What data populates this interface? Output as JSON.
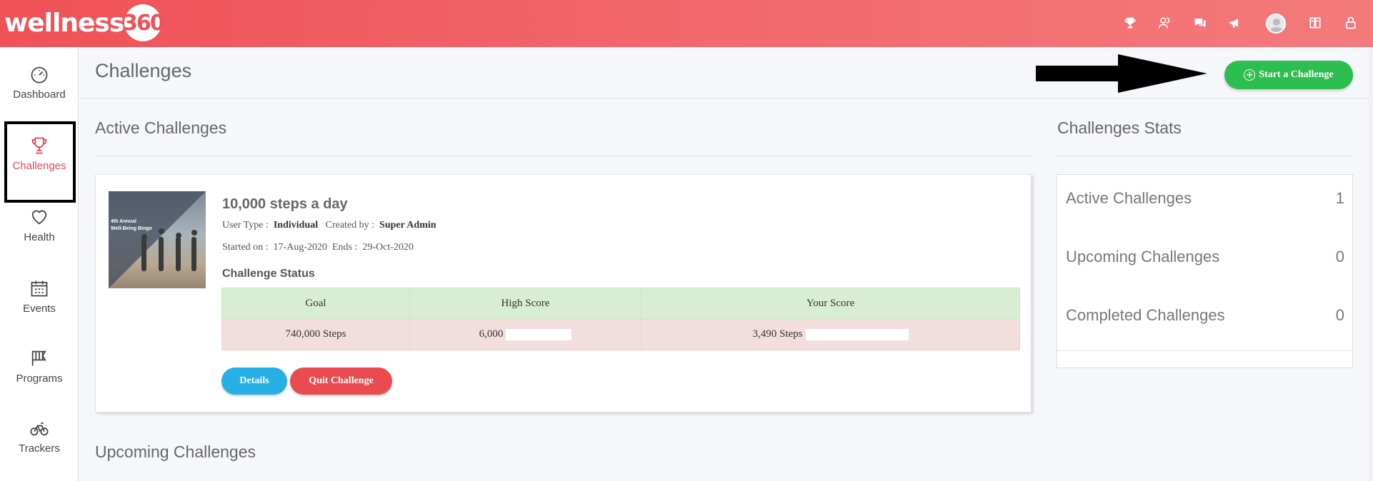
{
  "brand": {
    "name": "wellness",
    "badge": "360"
  },
  "topbar": {
    "icons": [
      "trophy-icon",
      "users-icon",
      "chat-icon",
      "megaphone-icon",
      "avatar",
      "book-icon",
      "lock-icon"
    ]
  },
  "sidebar": {
    "items": [
      {
        "label": "Dashboard",
        "icon": "speedometer-icon"
      },
      {
        "label": "Challenges",
        "icon": "trophy-icon",
        "active": true
      },
      {
        "label": "Health",
        "icon": "heart-icon"
      },
      {
        "label": "Events",
        "icon": "calendar-icon"
      },
      {
        "label": "Programs",
        "icon": "flag-icon"
      },
      {
        "label": "Trackers",
        "icon": "bicycle-icon"
      }
    ]
  },
  "header": {
    "title": "Challenges",
    "start_button": "Start a Challenge"
  },
  "active_section": {
    "title": "Active Challenges",
    "challenge": {
      "thumb_caption_line1": "4th Annual",
      "thumb_caption_line2": "Well-Being Bingo",
      "title": "10,000 steps a day",
      "user_type_label": "User Type :",
      "user_type": "Individual",
      "created_by_label": "Created by :",
      "created_by": "Super Admin",
      "started_label": "Started on :",
      "started": "17-Aug-2020",
      "ends_label": "Ends :",
      "ends": "29-Oct-2020",
      "status_label": "Challenge Status",
      "table": {
        "headers": [
          "Goal",
          "High Score",
          "Your Score"
        ],
        "goal": "740,000 Steps",
        "high_score": "6,000",
        "your_score": "3,490 Steps"
      },
      "details_button": "Details",
      "quit_button": "Quit Challenge"
    }
  },
  "upcoming_section": {
    "title": "Upcoming Challenges"
  },
  "stats": {
    "title": "Challenges Stats",
    "rows": [
      {
        "label": "Active Challenges",
        "value": "1"
      },
      {
        "label": "Upcoming Challenges",
        "value": "0"
      },
      {
        "label": "Completed Challenges",
        "value": "0"
      }
    ]
  },
  "colors": {
    "brand": "#ef5156",
    "start_button": "#2cbe4e",
    "details_button": "#26b0e6",
    "quit_button": "#ea4b4f",
    "table_header": "#d8eed3",
    "table_row": "#f3dede"
  }
}
